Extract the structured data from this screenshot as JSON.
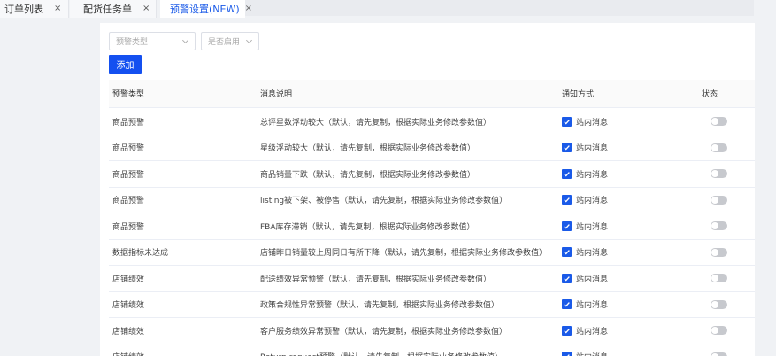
{
  "tabs": [
    {
      "label": "订单列表",
      "active": false
    },
    {
      "label": "配货任务单",
      "active": false
    },
    {
      "label": "预警设置(NEW)",
      "active": true
    }
  ],
  "close_glyph": "×",
  "filters": {
    "warning_type_placeholder": "预警类型",
    "enabled_placeholder": "是否启用"
  },
  "add_button": "添加",
  "table": {
    "headers": [
      "预警类型",
      "消息说明",
      "通知方式",
      "状态"
    ],
    "rows": [
      {
        "type": "商品预警",
        "message": "总评星数浮动较大（默认，请先复制，根据实际业务修改参数值）",
        "notify": "站内消息",
        "checked": true,
        "enabled": false
      },
      {
        "type": "商品预警",
        "message": "星级浮动较大（默认，请先复制，根据实际业务修改参数值）",
        "notify": "站内消息",
        "checked": true,
        "enabled": false
      },
      {
        "type": "商品预警",
        "message": "商品销量下跌（默认，请先复制，根据实际业务修改参数值）",
        "notify": "站内消息",
        "checked": true,
        "enabled": false
      },
      {
        "type": "商品预警",
        "message": "listing被下架、被停售（默认，请先复制，根据实际业务修改参数值）",
        "notify": "站内消息",
        "checked": true,
        "enabled": false
      },
      {
        "type": "商品预警",
        "message": "FBA库存滞销（默认，请先复制，根据实际业务修改参数值）",
        "notify": "站内消息",
        "checked": true,
        "enabled": false
      },
      {
        "type": "数据指标未达成",
        "message": "店铺昨日销量较上周同日有所下降（默认，请先复制，根据实际业务修改参数值）",
        "notify": "站内消息",
        "checked": true,
        "enabled": false
      },
      {
        "type": "店铺绩效",
        "message": "配送绩效异常预警（默认，请先复制，根据实际业务修改参数值）",
        "notify": "站内消息",
        "checked": true,
        "enabled": false
      },
      {
        "type": "店铺绩效",
        "message": "政策合规性异常预警（默认，请先复制，根据实际业务修改参数值）",
        "notify": "站内消息",
        "checked": true,
        "enabled": false
      },
      {
        "type": "店铺绩效",
        "message": "客户服务绩效异常预警（默认，请先复制，根据实际业务修改参数值）",
        "notify": "站内消息",
        "checked": true,
        "enabled": false
      },
      {
        "type": "店铺绩效",
        "message": "Return request预警（默认，请先复制，根据实际业务修改参数值）",
        "notify": "站内消息",
        "checked": true,
        "enabled": false
      }
    ]
  },
  "colors": {
    "accent": "#1a5ae8",
    "button": "#1450f0",
    "switch_off": "#c7c9ce"
  }
}
